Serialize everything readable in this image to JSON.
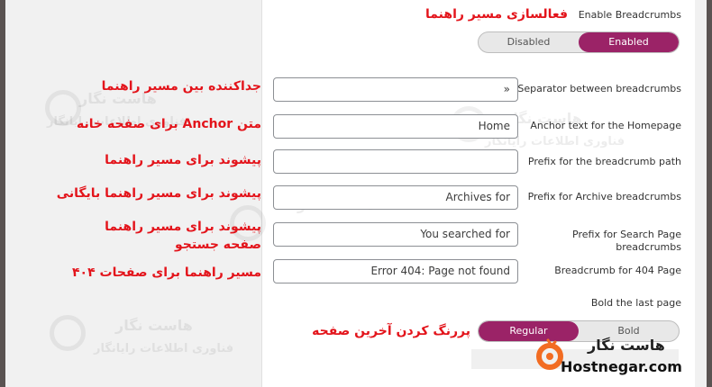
{
  "settings": {
    "enable_breadcrumbs": {
      "label": "Enable Breadcrumbs",
      "options": [
        "Disabled",
        "Enabled"
      ],
      "selected": "Enabled"
    },
    "separator": {
      "label": "Separator between breadcrumbs",
      "value": "»"
    },
    "anchor_text": {
      "label": "Anchor text for the Homepage",
      "value": "Home"
    },
    "prefix_path": {
      "label": "Prefix for the breadcrumb path",
      "value": ""
    },
    "prefix_archive": {
      "label": "Prefix for Archive breadcrumbs",
      "value": "Archives for"
    },
    "prefix_search": {
      "label": "Prefix for Search Page breadcrumbs",
      "value": "You searched for"
    },
    "crumb_404": {
      "label": "Breadcrumb for 404 Page",
      "value": "Error 404: Page not found"
    },
    "bold_last": {
      "label": "Bold the last page",
      "options": [
        "Regular",
        "Bold"
      ],
      "selected": "Regular"
    }
  },
  "annotations": {
    "enable": "فعالسازی مسیر راهنما",
    "separator": "جداکننده بین مسیر راهنما",
    "anchor": "متن Anchor برای صفحه خانه",
    "prefix_path": "پیشوند برای مسیر راهنما",
    "prefix_archive": "پیشوند برای مسیر راهنما بایگانی",
    "prefix_search_line1": "پیشوند برای مسیر راهنما",
    "prefix_search_line2": "صفحه جستجو",
    "crumb_404": "مسیر راهنما برای صفحات ۴۰۴",
    "bold_last": "پررنگ کردن آخرین صفحه"
  },
  "watermark": {
    "brand_fa": "هاست نگار",
    "tagline_fa": "فناوری اطلاعات رایانگار"
  },
  "logo": {
    "name_fa": "هاست نگار",
    "name_en": "Hostnegar.com"
  },
  "colors": {
    "accent": "#9b2367",
    "annotation": "#e3141b",
    "logo_orange": "#f26c22"
  },
  "icons": [
    "hostnegar-logo-icon"
  ]
}
